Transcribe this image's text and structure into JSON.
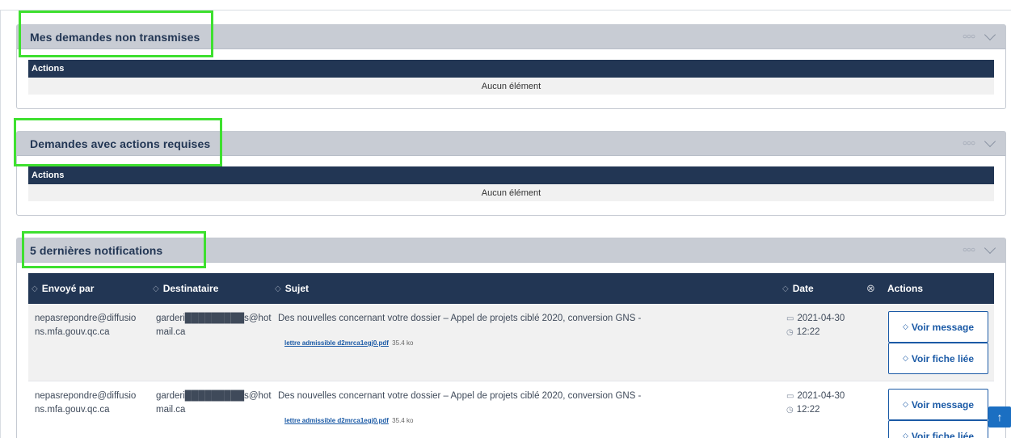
{
  "panels": {
    "non_transmises": {
      "title": "Mes demandes non transmises",
      "column": "Actions",
      "empty": "Aucun élément"
    },
    "actions_requises": {
      "title": "Demandes avec actions requises",
      "column": "Actions",
      "empty": "Aucun élément"
    },
    "notifications": {
      "title": "5 dernières notifications",
      "columns": {
        "sender": "Envoyé par",
        "recipient": "Destinataire",
        "subject": "Sujet",
        "date": "Date",
        "actions": "Actions"
      },
      "rows": [
        {
          "sender_line1": "nepasrepondre@diffusio",
          "sender_line2": "ns.mfa.gouv.qc.ca",
          "recipient_line1": "garderi█████████s@hot",
          "recipient_line2": "mail.ca",
          "subject": "Des nouvelles concernant votre dossier – Appel de projets ciblé 2020, conversion GNS -",
          "attachment_name": "lettre admissible d2mrca1egj0.pdf",
          "attachment_size": "35.4 ko",
          "date": "2021-04-30",
          "time": "12:22",
          "btn_message": "Voir message",
          "btn_fiche": "Voir fiche liée"
        },
        {
          "sender_line1": "nepasrepondre@diffusio",
          "sender_line2": "ns.mfa.gouv.qc.ca",
          "recipient_line1": "garderi█████████s@hot",
          "recipient_line2": "mail.ca",
          "subject": "Des nouvelles concernant votre dossier – Appel de projets ciblé 2020, conversion GNS -",
          "attachment_name": "lettre admissible d2mrca1egj0.pdf",
          "attachment_size": "35.4 ko",
          "date": "2021-04-30",
          "time": "12:22",
          "btn_message": "Voir message",
          "btn_fiche": "Voir fiche liée"
        }
      ]
    }
  },
  "icons": {
    "more": "more-icon",
    "chevron": "chevron-down-icon",
    "sort": "sort-icon",
    "clear": "clear-filter-icon",
    "calendar": "calendar-icon",
    "clock": "clock-icon",
    "eye": "eye-icon",
    "scroll_top": "arrow-up-icon"
  },
  "colors": {
    "header_bg": "#223654",
    "panel_header_bg": "#c8ccd4",
    "highlight": "#3ee02f",
    "link": "#1b5aa6"
  }
}
